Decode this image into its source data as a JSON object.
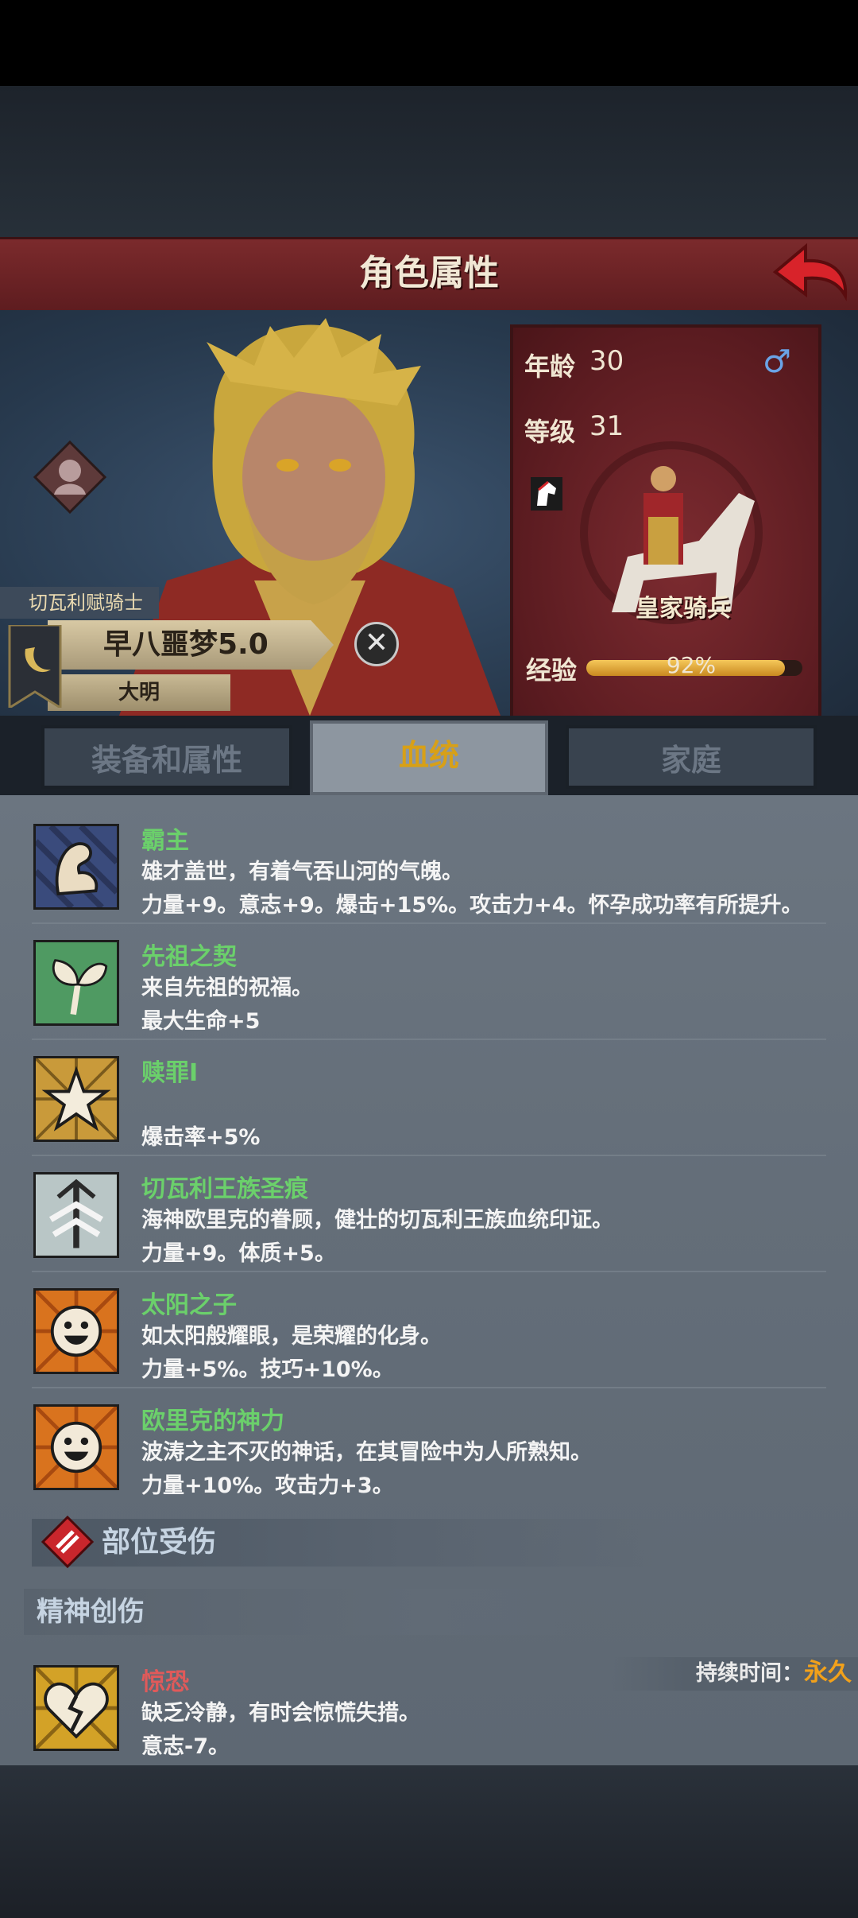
{
  "header": {
    "title": "角色属性"
  },
  "character": {
    "title_tag": "切瓦利赋骑士",
    "name": "早八噩梦5.0",
    "faction": "大明"
  },
  "stats": {
    "age_label": "年龄",
    "age_value": "30",
    "gender_symbol": "♂",
    "level_label": "等级",
    "level_value": "31",
    "unit_name": "皇家骑兵",
    "xp_label": "经验",
    "xp_percent_text": "92%",
    "xp_fraction": 0.92
  },
  "tabs": [
    {
      "label": "装备和属性"
    },
    {
      "label": "血统"
    },
    {
      "label": "家庭"
    }
  ],
  "traits": [
    {
      "name": "霸主",
      "desc": "雄才盖世，有着气吞山河的气魄。",
      "effect": "力量+9。意志+9。爆击+15%。攻击力+4。怀孕成功率有所提升。",
      "icon": "muscle-arm-icon"
    },
    {
      "name": "先祖之契",
      "desc": "来自先祖的祝福。",
      "effect": "最大生命+5",
      "icon": "sprout-icon"
    },
    {
      "name": "赎罪I",
      "desc": "",
      "effect": "爆击率+5%",
      "icon": "star-burst-icon"
    },
    {
      "name": "切瓦利王族圣痕",
      "desc": "海神欧里克的眷顾，健壮的切瓦利王族血统印证。",
      "effect": "力量+9。体质+5。",
      "icon": "trident-icon"
    },
    {
      "name": "太阳之子",
      "desc": "如太阳般耀眼，是荣耀的化身。",
      "effect": "力量+5%。技巧+10%。",
      "icon": "smiley-sun-icon"
    },
    {
      "name": "欧里克的神力",
      "desc": "波涛之主不灭的神话，在其冒险中为人所熟知。",
      "effect": "力量+10%。攻击力+3。",
      "icon": "smiley-sun-icon"
    }
  ],
  "sections": {
    "injury_label": "部位受伤",
    "mental_label": "精神创伤"
  },
  "mental_trauma": {
    "name": "惊恐",
    "desc": "缺乏冷静，有时会惊慌失措。",
    "effect": "意志-7。",
    "duration_label": "持续时间：",
    "duration_value": "永久",
    "icon": "broken-heart-icon"
  },
  "colors": {
    "trait_name": "#6bd06b",
    "trauma_name": "#e05a5a",
    "active_tab": "#d8a017",
    "banner": "#6d2326"
  }
}
